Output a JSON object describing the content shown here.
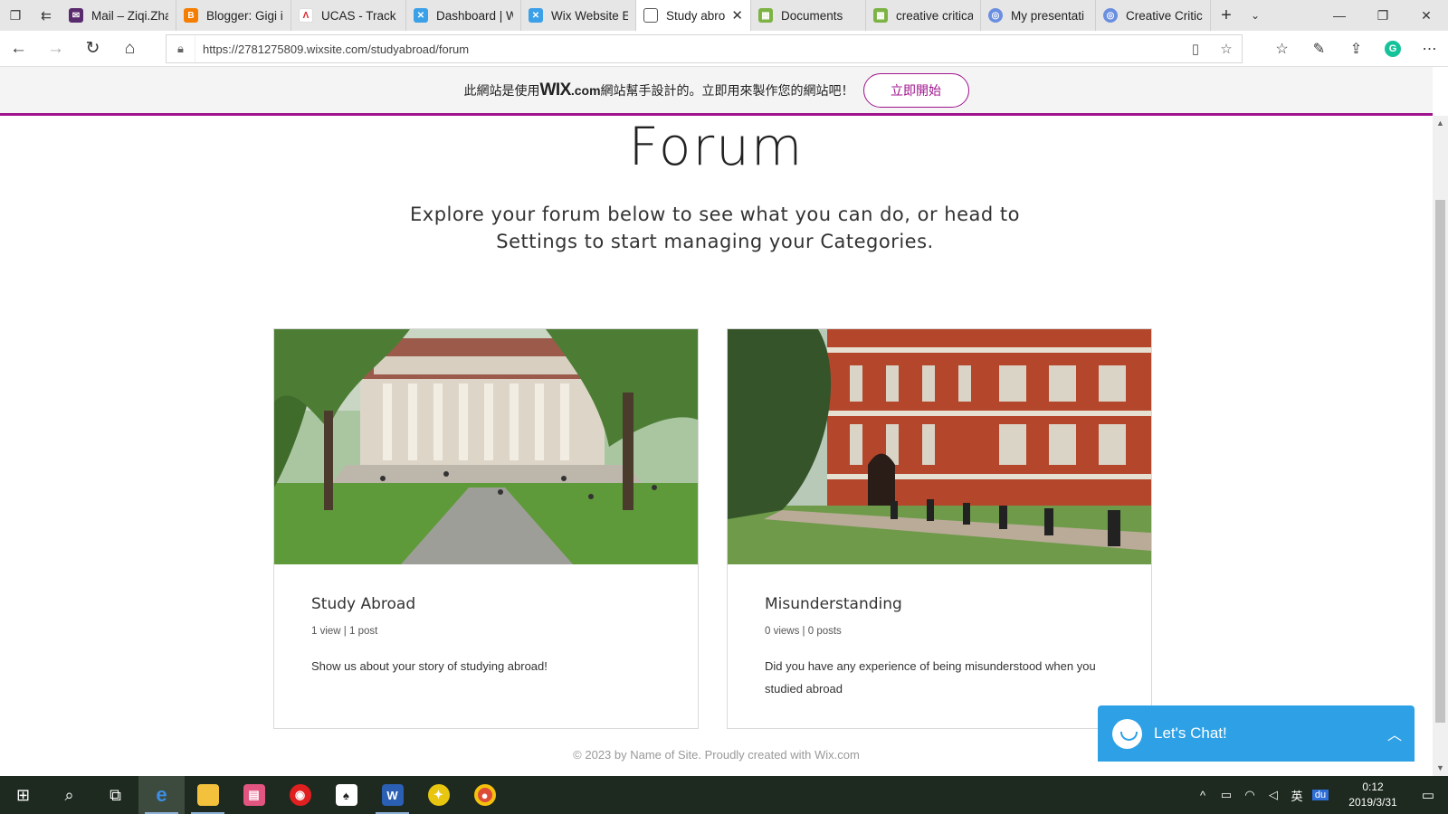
{
  "browser": {
    "tabs": [
      {
        "title": "Mail – Ziqi.Zha",
        "icon": "mail-icon",
        "color": "#5a2a6e"
      },
      {
        "title": "Blogger: Gigi i",
        "icon": "blogger-icon",
        "color": "#f57d00"
      },
      {
        "title": "UCAS - Track",
        "icon": "ucas-icon",
        "color": "#d9262b"
      },
      {
        "title": "Dashboard | W",
        "icon": "wix-icon",
        "color": "#3aa0e8"
      },
      {
        "title": "Wix Website E",
        "icon": "wix-icon",
        "color": "#3aa0e8"
      },
      {
        "title": "Study abro",
        "icon": "page-icon",
        "color": "#555555",
        "active": true
      },
      {
        "title": "Documents",
        "icon": "docs-icon",
        "color": "#7cb342"
      },
      {
        "title": "creative critica",
        "icon": "docs-icon",
        "color": "#7cb342"
      },
      {
        "title": "My presentati",
        "icon": "globe-icon",
        "color": "#6b8fe0"
      },
      {
        "title": "Creative Critic",
        "icon": "globe-icon",
        "color": "#6b8fe0"
      }
    ],
    "url": "https://2781275809.wixsite.com/studyabroad/forum"
  },
  "wix_banner": {
    "message_pre": "此網站是使用",
    "brand": "WIX",
    "brand_suffix": ".com",
    "message_post": "網站幫手設計的。立即用來製作您的網站吧！",
    "start_label": "立即開始"
  },
  "page": {
    "title": "Forum",
    "subtitle_line1": "Explore your forum below to see what you can do, or head to",
    "subtitle_line2": "Settings to start managing your Categories.",
    "categories": [
      {
        "name": "Study Abroad",
        "stats": "1 view | 1 post",
        "description": "Show us about your story of studying abroad!"
      },
      {
        "name": "Misunderstanding",
        "stats": "0 views | 0 posts",
        "description": "Did you have any experience of being misunderstood when you studied abroad"
      }
    ],
    "footer": "© 2023 by Name of Site. Proudly created with Wix.com",
    "chat_label": "Let's Chat!"
  },
  "taskbar": {
    "tray_lang": "英",
    "tray_app": "du",
    "time": "0:12",
    "date": "2019/3/31"
  },
  "colors": {
    "wix_purple": "#a0138e",
    "chat_blue": "#2ea1e6",
    "taskbar": "#1e2a1f"
  }
}
